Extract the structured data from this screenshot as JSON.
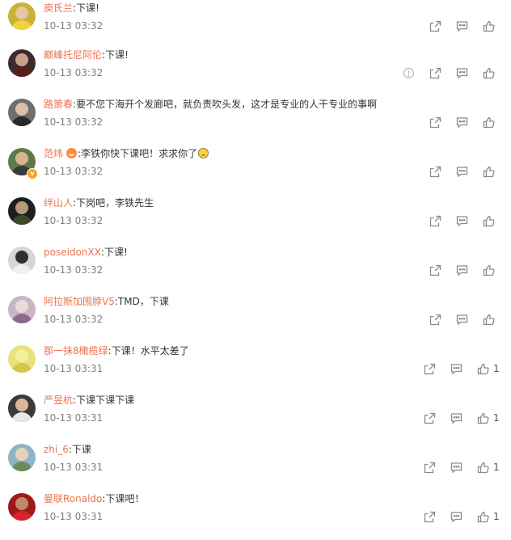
{
  "colors": {
    "username": "#eb7350",
    "text": "#333333",
    "time": "#808080",
    "icon": "#8a8a8a"
  },
  "comments": [
    {
      "user": "庾氏兰",
      "text": "下课!",
      "time": "10-13 03:32",
      "likes": "",
      "report": false,
      "avatar": {
        "bg": "#c9b13a",
        "head": "#e7c79c",
        "body": "#f0d23c"
      }
    },
    {
      "user": "巅峰托尼阿伦",
      "text": "下课!",
      "time": "10-13 03:32",
      "likes": "",
      "report": true,
      "avatar": {
        "bg": "#3d2a2a",
        "head": "#c9a08a",
        "body": "#5a1e1e"
      }
    },
    {
      "user": "路箫春",
      "text": "要不您下海开个发廊吧，就负责吹头发，这才是专业的人干专业的事啊",
      "time": "10-13 03:32",
      "likes": "",
      "report": false,
      "avatar": {
        "bg": "#6e6e6e",
        "head": "#d9c1a6",
        "body": "#2a2a2a"
      }
    },
    {
      "user": "范炜",
      "text_before": "李铁你快下课吧！求求你了",
      "time": "10-13 03:32",
      "likes": "",
      "report": false,
      "vip": true,
      "sad": true,
      "avatar": {
        "bg": "#5e7a4a",
        "head": "#d8b48e",
        "body": "#3a3a3a"
      }
    },
    {
      "user": "绊山人",
      "text": "下岗吧，李铁先生",
      "time": "10-13 03:32",
      "likes": "",
      "report": false,
      "avatar": {
        "bg": "#1e1e1e",
        "head": "#b49a7a",
        "body": "#3a4a2a"
      }
    },
    {
      "user": "poseidonXX",
      "text": "下课!",
      "time": "10-13 03:32",
      "likes": "",
      "report": false,
      "avatar": {
        "bg": "#d6d6d6",
        "head": "#303030",
        "body": "#f0f0f0"
      }
    },
    {
      "user": "阿拉斯加围脖V5",
      "text": "TMD，下课",
      "time": "10-13 03:32",
      "likes": "",
      "report": false,
      "avatar": {
        "bg": "#c9b4c8",
        "head": "#eadbd9",
        "body": "#8a6b8a"
      }
    },
    {
      "user": "那一抹8橄榄绿",
      "text": "下课！水平太差了",
      "time": "10-13 03:31",
      "likes": "1",
      "report": false,
      "avatar": {
        "bg": "#e9e27a",
        "head": "#f4ef9a",
        "body": "#d3c84a"
      }
    },
    {
      "user": "严昱杭",
      "text": "下课下课下课",
      "time": "10-13 03:31",
      "likes": "1",
      "report": false,
      "avatar": {
        "bg": "#3a3a3a",
        "head": "#d9b89a",
        "body": "#e8e8e8"
      }
    },
    {
      "user": "zhi_6",
      "text": "下课",
      "time": "10-13 03:31",
      "likes": "1",
      "report": false,
      "avatar": {
        "bg": "#8fb4c8",
        "head": "#e7d2b8",
        "body": "#6e8a5a"
      }
    },
    {
      "user": "曼联Ronaldo",
      "text": "下课吧！",
      "time": "10-13 03:31",
      "likes": "1",
      "report": false,
      "avatar": {
        "bg": "#9e1a1a",
        "head": "#c28a6a",
        "body": "#d4252a"
      }
    }
  ]
}
